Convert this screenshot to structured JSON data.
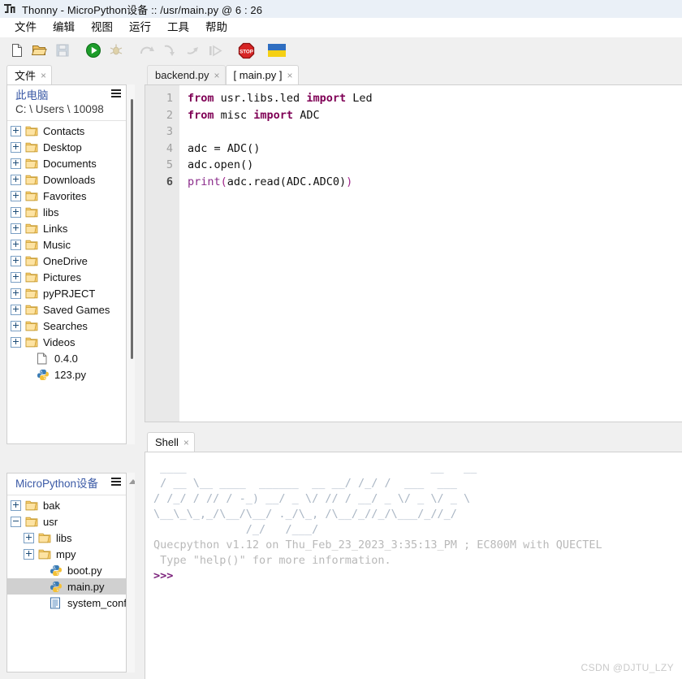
{
  "window": {
    "title": "Thonny  -  MicroPython设备 :: /usr/main.py  @  6 : 26",
    "icon": "thonny-logo-icon"
  },
  "menubar": {
    "items": [
      {
        "label": "文件"
      },
      {
        "label": "编辑"
      },
      {
        "label": "视图"
      },
      {
        "label": "运行"
      },
      {
        "label": "工具"
      },
      {
        "label": "帮助"
      }
    ]
  },
  "toolbar": {
    "buttons": [
      {
        "name": "new-file-icon",
        "enabled": true
      },
      {
        "name": "open-file-icon",
        "enabled": true
      },
      {
        "name": "save-file-icon",
        "enabled": false
      },
      {
        "name": "run-icon",
        "enabled": true
      },
      {
        "name": "debug-icon",
        "enabled": false
      },
      {
        "name": "step-over-icon",
        "enabled": false
      },
      {
        "name": "step-into-icon",
        "enabled": false
      },
      {
        "name": "step-out-icon",
        "enabled": false
      },
      {
        "name": "resume-icon",
        "enabled": false
      },
      {
        "name": "stop-icon",
        "enabled": true
      },
      {
        "name": "ukraine-flag-icon",
        "enabled": true
      }
    ]
  },
  "files_panel": {
    "tab_label": "文件",
    "tab_close": "×",
    "this_pc": {
      "title": "此电脑",
      "path": "C: \\ Users \\ 10098",
      "menu_icon": "hamburger-icon"
    },
    "items": [
      {
        "label": "Contacts",
        "type": "folder",
        "expandable": true,
        "depth": 0
      },
      {
        "label": "Desktop",
        "type": "folder",
        "expandable": true,
        "depth": 0
      },
      {
        "label": "Documents",
        "type": "folder",
        "expandable": true,
        "depth": 0
      },
      {
        "label": "Downloads",
        "type": "folder",
        "expandable": true,
        "depth": 0
      },
      {
        "label": "Favorites",
        "type": "folder",
        "expandable": true,
        "depth": 0
      },
      {
        "label": "libs",
        "type": "folder",
        "expandable": true,
        "depth": 0
      },
      {
        "label": "Links",
        "type": "folder",
        "expandable": true,
        "depth": 0
      },
      {
        "label": "Music",
        "type": "folder",
        "expandable": true,
        "depth": 0
      },
      {
        "label": "OneDrive",
        "type": "folder",
        "expandable": true,
        "depth": 0
      },
      {
        "label": "Pictures",
        "type": "folder",
        "expandable": true,
        "depth": 0
      },
      {
        "label": "pyPRJECT",
        "type": "folder",
        "expandable": true,
        "depth": 0
      },
      {
        "label": "Saved Games",
        "type": "folder",
        "expandable": true,
        "depth": 0
      },
      {
        "label": "Searches",
        "type": "folder",
        "expandable": true,
        "depth": 0
      },
      {
        "label": "Videos",
        "type": "folder",
        "expandable": true,
        "depth": 0
      },
      {
        "label": "0.4.0",
        "type": "file",
        "expandable": false,
        "depth": 1
      },
      {
        "label": "123.py",
        "type": "python",
        "expandable": false,
        "depth": 1
      }
    ]
  },
  "device_panel": {
    "title": "MicroPython设备",
    "menu_icon": "hamburger-icon",
    "items": [
      {
        "label": "bak",
        "type": "folder",
        "expandable": true,
        "expanded": false,
        "depth": 0,
        "selected": false
      },
      {
        "label": "usr",
        "type": "folder",
        "expandable": true,
        "expanded": true,
        "depth": 0,
        "selected": false
      },
      {
        "label": "libs",
        "type": "folder",
        "expandable": true,
        "expanded": false,
        "depth": 1,
        "selected": false
      },
      {
        "label": "mpy",
        "type": "folder",
        "expandable": true,
        "expanded": false,
        "depth": 1,
        "selected": false
      },
      {
        "label": "boot.py",
        "type": "python",
        "expandable": false,
        "depth": 2,
        "selected": false
      },
      {
        "label": "main.py",
        "type": "python",
        "expandable": false,
        "depth": 2,
        "selected": true
      },
      {
        "label": "system_config.j",
        "type": "textfile",
        "expandable": false,
        "depth": 2,
        "selected": false
      }
    ]
  },
  "editor": {
    "tabs": [
      {
        "label": "backend.py",
        "close": "×",
        "active": false
      },
      {
        "label": "[ main.py ]",
        "close": "×",
        "active": true
      }
    ],
    "line_numbers": [
      "1",
      "2",
      "3",
      "4",
      "5",
      "6"
    ],
    "current_line": 6,
    "lines": [
      {
        "n": "1",
        "tokens": [
          {
            "t": "from",
            "c": "kw"
          },
          {
            "t": " usr.libs.led ",
            "c": ""
          },
          {
            "t": "import",
            "c": "kw"
          },
          {
            "t": " Led",
            "c": ""
          }
        ]
      },
      {
        "n": "2",
        "tokens": [
          {
            "t": "from",
            "c": "kw"
          },
          {
            "t": " misc ",
            "c": ""
          },
          {
            "t": "import",
            "c": "kw"
          },
          {
            "t": " ADC",
            "c": ""
          }
        ]
      },
      {
        "n": "3",
        "tokens": []
      },
      {
        "n": "4",
        "tokens": [
          {
            "t": "adc = ADC()",
            "c": ""
          }
        ]
      },
      {
        "n": "5",
        "tokens": [
          {
            "t": "adc.open()",
            "c": ""
          }
        ]
      },
      {
        "n": "6",
        "tokens": [
          {
            "t": "print",
            "c": "fn"
          },
          {
            "t": "(",
            "c": "paren"
          },
          {
            "t": "adc.read(ADC.ADC0)",
            "c": ""
          },
          {
            "t": ")",
            "c": "paren"
          }
        ]
      }
    ]
  },
  "shell": {
    "tab_label": "Shell",
    "tab_close": "×",
    "banner": [
      " ____                                     __   __",
      " / __ \\__ ____  ______  __ __/ /_/ /  ___  ___",
      "/ /_/ / // / -_) __/ _ \\/ // / __/ _ \\/ _ \\/ _ \\",
      "\\__\\_\\_,_/\\__/\\__/ ._/\\_, /\\__/_//_/\\___/_//_/",
      "              /_/   /___/"
    ],
    "version_line": "Quecpython v1.12 on Thu_Feb_23_2023_3:35:13_PM ; EC800M with QUECTEL",
    "help_line": " Type \"help()\" for more information.",
    "prompt": ">>>"
  },
  "watermark": "CSDN @DJTU_LZY",
  "colors": {
    "titlebar": "#eaf0f7",
    "menubar": "#ffffff",
    "toolbar": "#f0f0f0",
    "selection": "#d0d0d0",
    "keyword": "#7f0055",
    "function": "#8a2a8a",
    "prompt": "#7a1f7a",
    "tree_header": "#3b5aa6"
  }
}
